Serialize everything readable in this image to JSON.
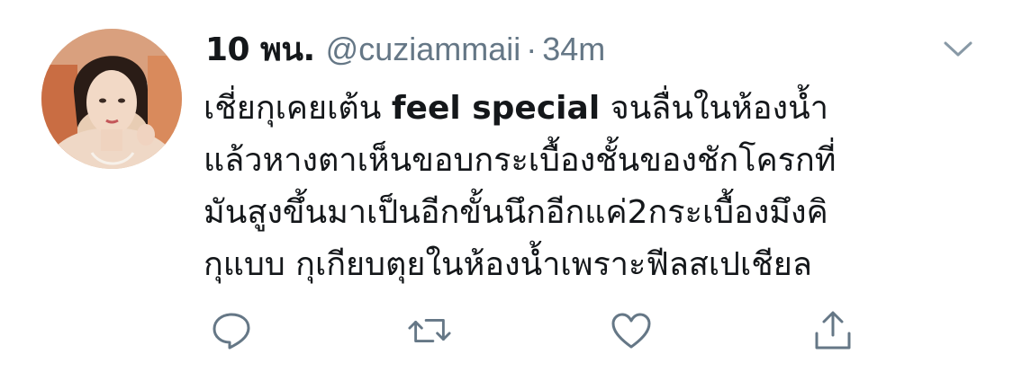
{
  "tweet": {
    "display_name": "10 พน.",
    "handle": "@cuziammaii",
    "separator": "·",
    "time": "34m",
    "text_lines": [
      {
        "pre": "เชี่ยกุเคยเต้น ",
        "bold": "feel special",
        "post": " จนลื่นในห้องน้ำ"
      },
      {
        "pre": "แล้วหางตาเห็นขอบกระเบื้องชั้นของชักโครกที่",
        "bold": "",
        "post": ""
      },
      {
        "pre": "มันสูงขึ้นมาเป็นอีกขั้นนึกอีกแค่2กระเบื้องมึงคิ",
        "bold": "",
        "post": ""
      },
      {
        "pre": "กุแบบ กุเกียบตุยในห้องน้ำเพราะฟีลสเปเชียล",
        "bold": "",
        "post": ""
      }
    ]
  },
  "actions": {
    "reply_icon": "reply-icon",
    "retweet_icon": "retweet-icon",
    "like_icon": "heart-icon",
    "share_icon": "share-icon",
    "more_icon": "chevron-down-icon"
  },
  "colors": {
    "text": "#14171a",
    "secondary": "#657786",
    "icon": "#657786"
  }
}
